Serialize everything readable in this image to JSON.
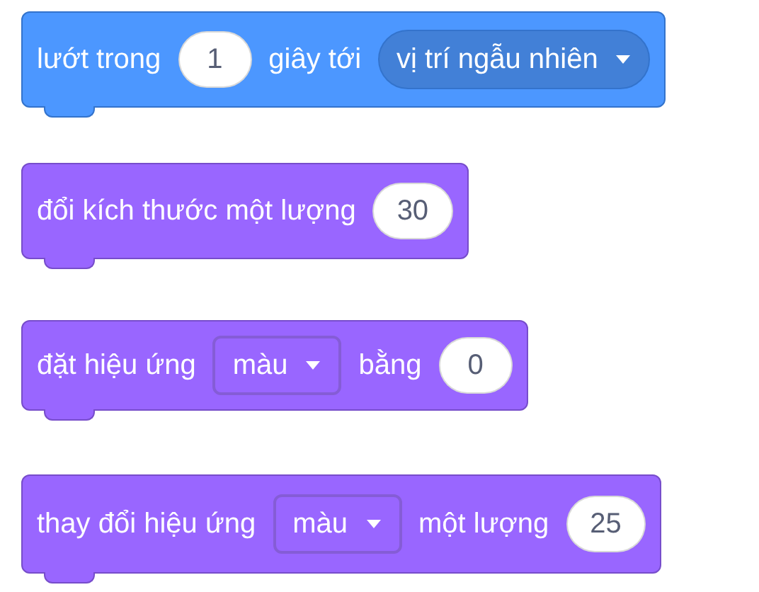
{
  "blocks": [
    {
      "color": "#4c97ff",
      "parts": [
        {
          "kind": "text",
          "text": "lướt trong"
        },
        {
          "kind": "number",
          "text": "1"
        },
        {
          "kind": "text",
          "text": "giây tới"
        },
        {
          "kind": "dropdown",
          "text": "vị trí ngẫu nhiên"
        }
      ]
    },
    {
      "color": "#9966ff",
      "parts": [
        {
          "kind": "text",
          "text": "đổi kích thước một lượng"
        },
        {
          "kind": "number",
          "text": "30"
        }
      ]
    },
    {
      "color": "#9966ff",
      "parts": [
        {
          "kind": "text",
          "text": "đặt hiệu ứng"
        },
        {
          "kind": "dropdown",
          "text": "màu"
        },
        {
          "kind": "text",
          "text": "bằng"
        },
        {
          "kind": "number",
          "text": "0"
        }
      ]
    },
    {
      "color": "#9966ff",
      "parts": [
        {
          "kind": "text",
          "text": "thay đổi hiệu ứng"
        },
        {
          "kind": "dropdown",
          "text": "màu"
        },
        {
          "kind": "text",
          "text": "một lượng"
        },
        {
          "kind": "number",
          "text": "25"
        }
      ]
    }
  ]
}
